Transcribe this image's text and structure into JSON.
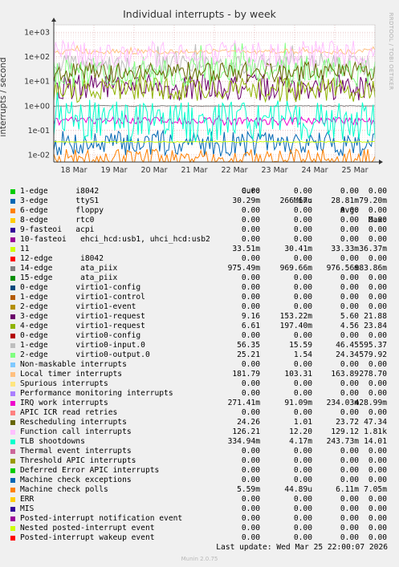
{
  "chart_data": {
    "type": "line",
    "title": "Individual interrupts - by week",
    "ylabel": "interrupts / second",
    "y_scale": "log",
    "ylim": [
      0.005,
      2000
    ],
    "y_ticks": [
      "1e+03",
      "1e+02",
      "1e+01",
      "1e+00",
      "1e-01",
      "1e-02"
    ],
    "x_ticks": [
      "18 Mar",
      "19 Mar",
      "20 Mar",
      "21 Mar",
      "22 Mar",
      "23 Mar",
      "24 Mar",
      "25 Mar"
    ],
    "grid": true,
    "series": [
      {
        "name": "1-edge      i8042",
        "color": "#00cc00",
        "cur": "0.00",
        "min": "0.00",
        "avg": "0.00",
        "max": "0.00"
      },
      {
        "name": "3-edge      ttyS1",
        "color": "#0066b3",
        "cur": "30.29m",
        "min": "266.67u",
        "avg": "28.81m",
        "max": "79.20m"
      },
      {
        "name": "6-edge      floppy",
        "color": "#ff8000",
        "cur": "0.00",
        "min": "0.00",
        "avg": "0.00",
        "max": "0.00"
      },
      {
        "name": "8-edge      rtc0",
        "color": "#ffcc00",
        "cur": "0.00",
        "min": "0.00",
        "avg": "0.00",
        "max": "0.00"
      },
      {
        "name": "9-fasteoi   acpi",
        "color": "#330099",
        "cur": "0.00",
        "min": "0.00",
        "avg": "0.00",
        "max": "0.00"
      },
      {
        "name": "10-fasteoi   ehci_hcd:usb1, uhci_hcd:usb2",
        "color": "#990099",
        "cur": "0.00",
        "min": "0.00",
        "avg": "0.00",
        "max": "0.00"
      },
      {
        "name": "11",
        "color": "#ccff00",
        "cur": "33.51m",
        "min": "30.41m",
        "avg": "33.33m",
        "max": "36.37m"
      },
      {
        "name": "12-edge      i8042",
        "color": "#ff0000",
        "cur": "0.00",
        "min": "0.00",
        "avg": "0.00",
        "max": "0.00"
      },
      {
        "name": "14-edge      ata_piix",
        "color": "#808080",
        "cur": "975.49m",
        "min": "969.66m",
        "avg": "976.56m",
        "max": "983.86m"
      },
      {
        "name": "15-edge      ata_piix",
        "color": "#008f00",
        "cur": "0.00",
        "min": "0.00",
        "avg": "0.00",
        "max": "0.00"
      },
      {
        "name": "0-edge      virtio1-config",
        "color": "#00487d",
        "cur": "0.00",
        "min": "0.00",
        "avg": "0.00",
        "max": "0.00"
      },
      {
        "name": "1-edge      virtio1-control",
        "color": "#b35a00",
        "cur": "0.00",
        "min": "0.00",
        "avg": "0.00",
        "max": "0.00"
      },
      {
        "name": "2-edge      virtio1-event",
        "color": "#b38f00",
        "cur": "0.00",
        "min": "0.00",
        "avg": "0.00",
        "max": "0.00"
      },
      {
        "name": "3-edge      virtio1-request",
        "color": "#6b006b",
        "cur": "9.16",
        "min": "153.22m",
        "avg": "5.60",
        "max": "21.88"
      },
      {
        "name": "4-edge      virtio1-request",
        "color": "#8fb300",
        "cur": "6.61",
        "min": "197.40m",
        "avg": "4.56",
        "max": "23.84"
      },
      {
        "name": "0-edge      virtio0-config",
        "color": "#b30000",
        "cur": "0.00",
        "min": "0.00",
        "avg": "0.00",
        "max": "0.00"
      },
      {
        "name": "1-edge      virtio0-input.0",
        "color": "#bebebe",
        "cur": "56.35",
        "min": "15.59",
        "avg": "46.45",
        "max": "595.37"
      },
      {
        "name": "2-edge      virtio0-output.0",
        "color": "#80ff80",
        "cur": "25.21",
        "min": "1.54",
        "avg": "24.34",
        "max": "579.92"
      },
      {
        "name": "Non-maskable interrupts",
        "color": "#80c9ff",
        "cur": "0.00",
        "min": "0.00",
        "avg": "0.00",
        "max": "0.00"
      },
      {
        "name": "Local timer interrupts",
        "color": "#ffc080",
        "cur": "181.79",
        "min": "103.31",
        "avg": "163.89",
        "max": "278.70"
      },
      {
        "name": "Spurious interrupts",
        "color": "#ffe680",
        "cur": "0.00",
        "min": "0.00",
        "avg": "0.00",
        "max": "0.00"
      },
      {
        "name": "Performance monitoring interrupts",
        "color": "#aa80ff",
        "cur": "0.00",
        "min": "0.00",
        "avg": "0.00",
        "max": "0.00"
      },
      {
        "name": "IRQ work interrupts",
        "color": "#ee00cc",
        "cur": "271.41m",
        "min": "91.09m",
        "avg": "234.03m",
        "max": "428.99m"
      },
      {
        "name": "APIC ICR read retries",
        "color": "#ff8080",
        "cur": "0.00",
        "min": "0.00",
        "avg": "0.00",
        "max": "0.00"
      },
      {
        "name": "Rescheduling interrupts",
        "color": "#666600",
        "cur": "24.26",
        "min": "1.01",
        "avg": "23.72",
        "max": "47.34"
      },
      {
        "name": "Function call interrupts",
        "color": "#ffbfff",
        "cur": "126.21",
        "min": "12.20",
        "avg": "129.12",
        "max": "1.81k"
      },
      {
        "name": "TLB shootdowns",
        "color": "#00ffcc",
        "cur": "334.94m",
        "min": "4.17m",
        "avg": "243.73m",
        "max": "14.01"
      },
      {
        "name": "Thermal event interrupts",
        "color": "#cc6699",
        "cur": "0.00",
        "min": "0.00",
        "avg": "0.00",
        "max": "0.00"
      },
      {
        "name": "Threshold APIC interrupts",
        "color": "#999900",
        "cur": "0.00",
        "min": "0.00",
        "avg": "0.00",
        "max": "0.00"
      },
      {
        "name": "Deferred Error APIC interrupts",
        "color": "#00cc00",
        "cur": "0.00",
        "min": "0.00",
        "avg": "0.00",
        "max": "0.00"
      },
      {
        "name": "Machine check exceptions",
        "color": "#0066b3",
        "cur": "0.00",
        "min": "0.00",
        "avg": "0.00",
        "max": "0.00"
      },
      {
        "name": "Machine check polls",
        "color": "#ff8000",
        "cur": "5.59m",
        "min": "44.89u",
        "avg": "6.11m",
        "max": "7.05m"
      },
      {
        "name": "ERR",
        "color": "#ffcc00",
        "cur": "0.00",
        "min": "0.00",
        "avg": "0.00",
        "max": "0.00"
      },
      {
        "name": "MIS",
        "color": "#330099",
        "cur": "0.00",
        "min": "0.00",
        "avg": "0.00",
        "max": "0.00"
      },
      {
        "name": "Posted-interrupt notification event",
        "color": "#990099",
        "cur": "0.00",
        "min": "0.00",
        "avg": "0.00",
        "max": "0.00"
      },
      {
        "name": "Nested posted-interrupt event",
        "color": "#ccff00",
        "cur": "0.00",
        "min": "0.00",
        "avg": "0.00",
        "max": "0.00"
      },
      {
        "name": "Posted-interrupt wakeup event",
        "color": "#ff0000",
        "cur": "0.00",
        "min": "0.00",
        "avg": "0.00",
        "max": "0.00"
      }
    ]
  },
  "legend_header": {
    "cur": "Cur:",
    "min": "Min:",
    "avg": "Avg:",
    "max": "Max:"
  },
  "last_update": "Last update: Wed Mar 25 22:00:07 2026",
  "watermark": "RRDTOOL / TOBI OETIKER",
  "footer": "Munin 2.0.75"
}
